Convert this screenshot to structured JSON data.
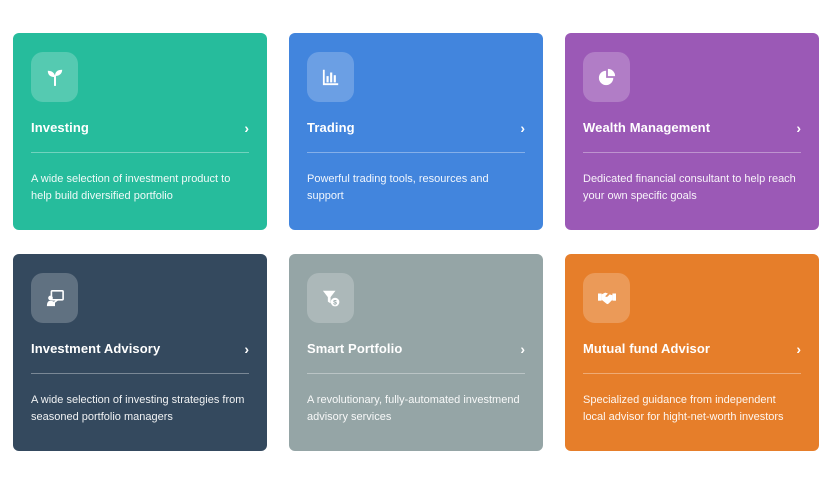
{
  "cards": [
    {
      "title": "Investing",
      "description": "A wide selection of investment product to help build diversified portfolio",
      "icon": "sprout-icon",
      "color": "#26bc9c"
    },
    {
      "title": "Trading",
      "description": "Powerful trading tools, resources and support",
      "icon": "bar-chart-icon",
      "color": "#4285dd"
    },
    {
      "title": "Wealth Management",
      "description": "Dedicated financial consultant to help reach your own specific goals",
      "icon": "pie-chart-icon",
      "color": "#9b59b6"
    },
    {
      "title": "Investment Advisory",
      "description": "A wide selection of investing strategies from seasoned portfolio managers",
      "icon": "presentation-icon",
      "color": "#34495e"
    },
    {
      "title": "Smart Portfolio",
      "description": "A revolutionary, fully-automated investmend advisory services",
      "icon": "funnel-dollar-icon",
      "color": "#95a5a6"
    },
    {
      "title": "Mutual fund Advisor",
      "description": "Specialized guidance from independent local advisor for hight-net-worth investors",
      "icon": "handshake-icon",
      "color": "#e67e2a"
    }
  ],
  "chevron": "›"
}
